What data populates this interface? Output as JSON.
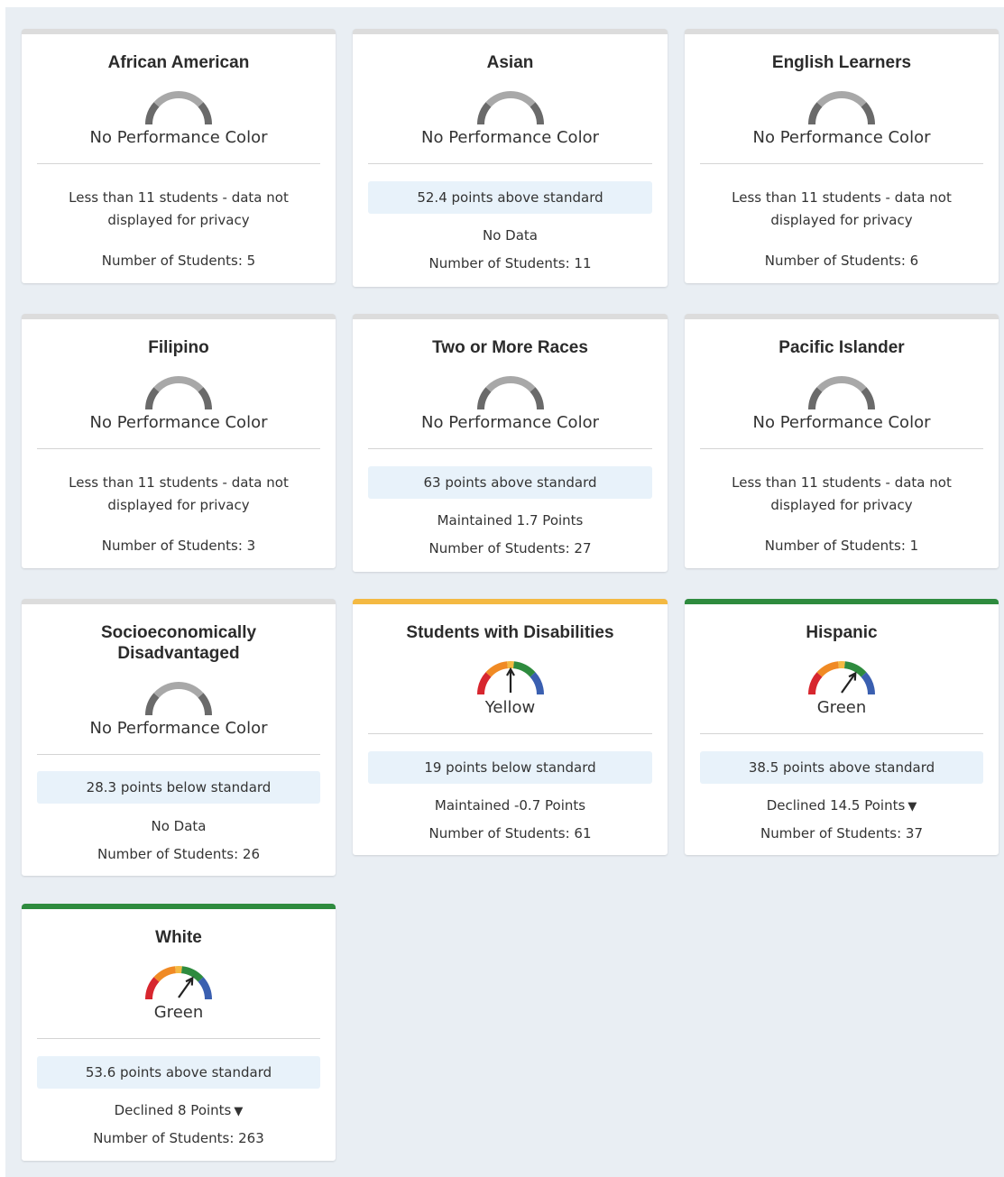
{
  "cards": [
    {
      "title": "African American",
      "color_label": "No Performance Color",
      "privacy": "Less than 11 students - data not displayed for privacy",
      "count": "Number of Students: 5",
      "top_color": "#dcdcdc",
      "gauge": "gray"
    },
    {
      "title": "Asian",
      "color_label": "No Performance Color",
      "status": "52.4 points above standard",
      "change": "No Data",
      "count": "Number of Students: 11",
      "top_color": "#dcdcdc",
      "gauge": "gray"
    },
    {
      "title": "English Learners",
      "color_label": "No Performance Color",
      "privacy": "Less than 11 students - data not displayed for privacy",
      "count": "Number of Students: 6",
      "top_color": "#dcdcdc",
      "gauge": "gray"
    },
    {
      "title": "Filipino",
      "color_label": "No Performance Color",
      "privacy": "Less than 11 students - data not displayed for privacy",
      "count": "Number of Students: 3",
      "top_color": "#dcdcdc",
      "gauge": "gray"
    },
    {
      "title": "Two or More Races",
      "color_label": "No Performance Color",
      "status": "63 points above standard",
      "change": "Maintained 1.7 Points",
      "count": "Number of Students: 27",
      "top_color": "#dcdcdc",
      "gauge": "gray"
    },
    {
      "title": "Pacific Islander",
      "color_label": "No Performance Color",
      "privacy": "Less than 11 students - data not displayed for privacy",
      "count": "Number of Students: 1",
      "top_color": "#dcdcdc",
      "gauge": "gray"
    },
    {
      "title": "Socioeconomically Disadvantaged",
      "color_label": "No Performance Color",
      "status": "28.3 points below standard",
      "change": "No Data",
      "count": "Number of Students: 26",
      "top_color": "#dcdcdc",
      "gauge": "gray"
    },
    {
      "title": "Students with Disabilities",
      "color_label": "Yellow",
      "status": "19 points below standard",
      "change": "Maintained -0.7 Points",
      "count": "Number of Students: 61",
      "top_color": "#f4b942",
      "gauge": "yellow"
    },
    {
      "title": "Hispanic",
      "color_label": "Green",
      "status": "38.5 points above standard",
      "change": "Declined 14.5 Points",
      "change_arrow": "▼",
      "count": "Number of Students: 37",
      "top_color": "#2e8b3e",
      "gauge": "green"
    },
    {
      "title": "White",
      "color_label": "Green",
      "status": "53.6 points above standard",
      "change": "Declined 8 Points",
      "change_arrow": "▼",
      "count": "Number of Students: 263",
      "top_color": "#2e8b3e",
      "gauge": "green"
    }
  ],
  "gauge_colors": {
    "red": "#d7262e",
    "orange": "#f08a24",
    "yellow": "#f4b942",
    "green": "#2e8b3e",
    "blue": "#3a5fb0",
    "gray_light": "#a8a8a8",
    "gray_dark": "#6a6a6a"
  },
  "icons": {
    "gauge": "performance-gauge-icon",
    "decline": "triangle-down-icon"
  }
}
